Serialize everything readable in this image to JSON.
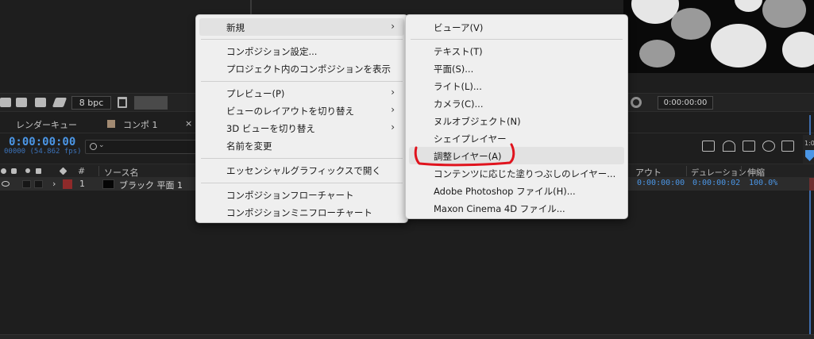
{
  "toolbar": {
    "bpc_label": "8 bpc",
    "timecode_field": "0:00:00:00"
  },
  "tabs": {
    "render_queue": "レンダーキュー",
    "comp": "コンポ 1",
    "close": "×"
  },
  "timeline": {
    "current_time": "0:00:00:00",
    "frames_fps": "00000 (54.862 fps)",
    "ruler_label": "1:0"
  },
  "columns": {
    "hash": "#",
    "source_name": "ソース名",
    "out": "アウト",
    "duration": "デュレーション",
    "stretch": "伸縮"
  },
  "layer": {
    "number": "1",
    "name": "ブラック 平面 1",
    "out": "0:00:00:00",
    "duration": "0:00:00:02",
    "stretch": "100.0%",
    "label_color": "#8f2a2a"
  },
  "context_menu": {
    "items": [
      {
        "label": "新規",
        "submenu": true
      },
      {
        "label": "コンポジション設定..."
      },
      {
        "label": "プロジェクト内のコンポジションを表示"
      },
      {
        "label": "プレビュー(P)",
        "submenu": true
      },
      {
        "label": "ビューのレイアウトを切り替え",
        "submenu": true
      },
      {
        "label": "3D ビューを切り替え",
        "submenu": true
      },
      {
        "label": "名前を変更"
      },
      {
        "label": "エッセンシャルグラフィックスで開く"
      },
      {
        "label": "コンポジションフローチャート"
      },
      {
        "label": "コンポジションミニフローチャート"
      }
    ]
  },
  "submenu": {
    "items": [
      {
        "label": "ビューア(V)"
      },
      {
        "label": "テキスト(T)"
      },
      {
        "label": "平面(S)..."
      },
      {
        "label": "ライト(L)..."
      },
      {
        "label": "カメラ(C)..."
      },
      {
        "label": "ヌルオブジェクト(N)"
      },
      {
        "label": "シェイプレイヤー"
      },
      {
        "label": "調整レイヤー(A)"
      },
      {
        "label": "コンテンツに応じた塗りつぶしのレイヤー..."
      },
      {
        "label": "Adobe Photoshop ファイル(H)..."
      },
      {
        "label": "Maxon Cinema 4D ファイル..."
      }
    ]
  },
  "colors": {
    "accent_blue": "#4b96e6",
    "annotation_red": "#e0141e",
    "menu_bg": "#efefef"
  }
}
